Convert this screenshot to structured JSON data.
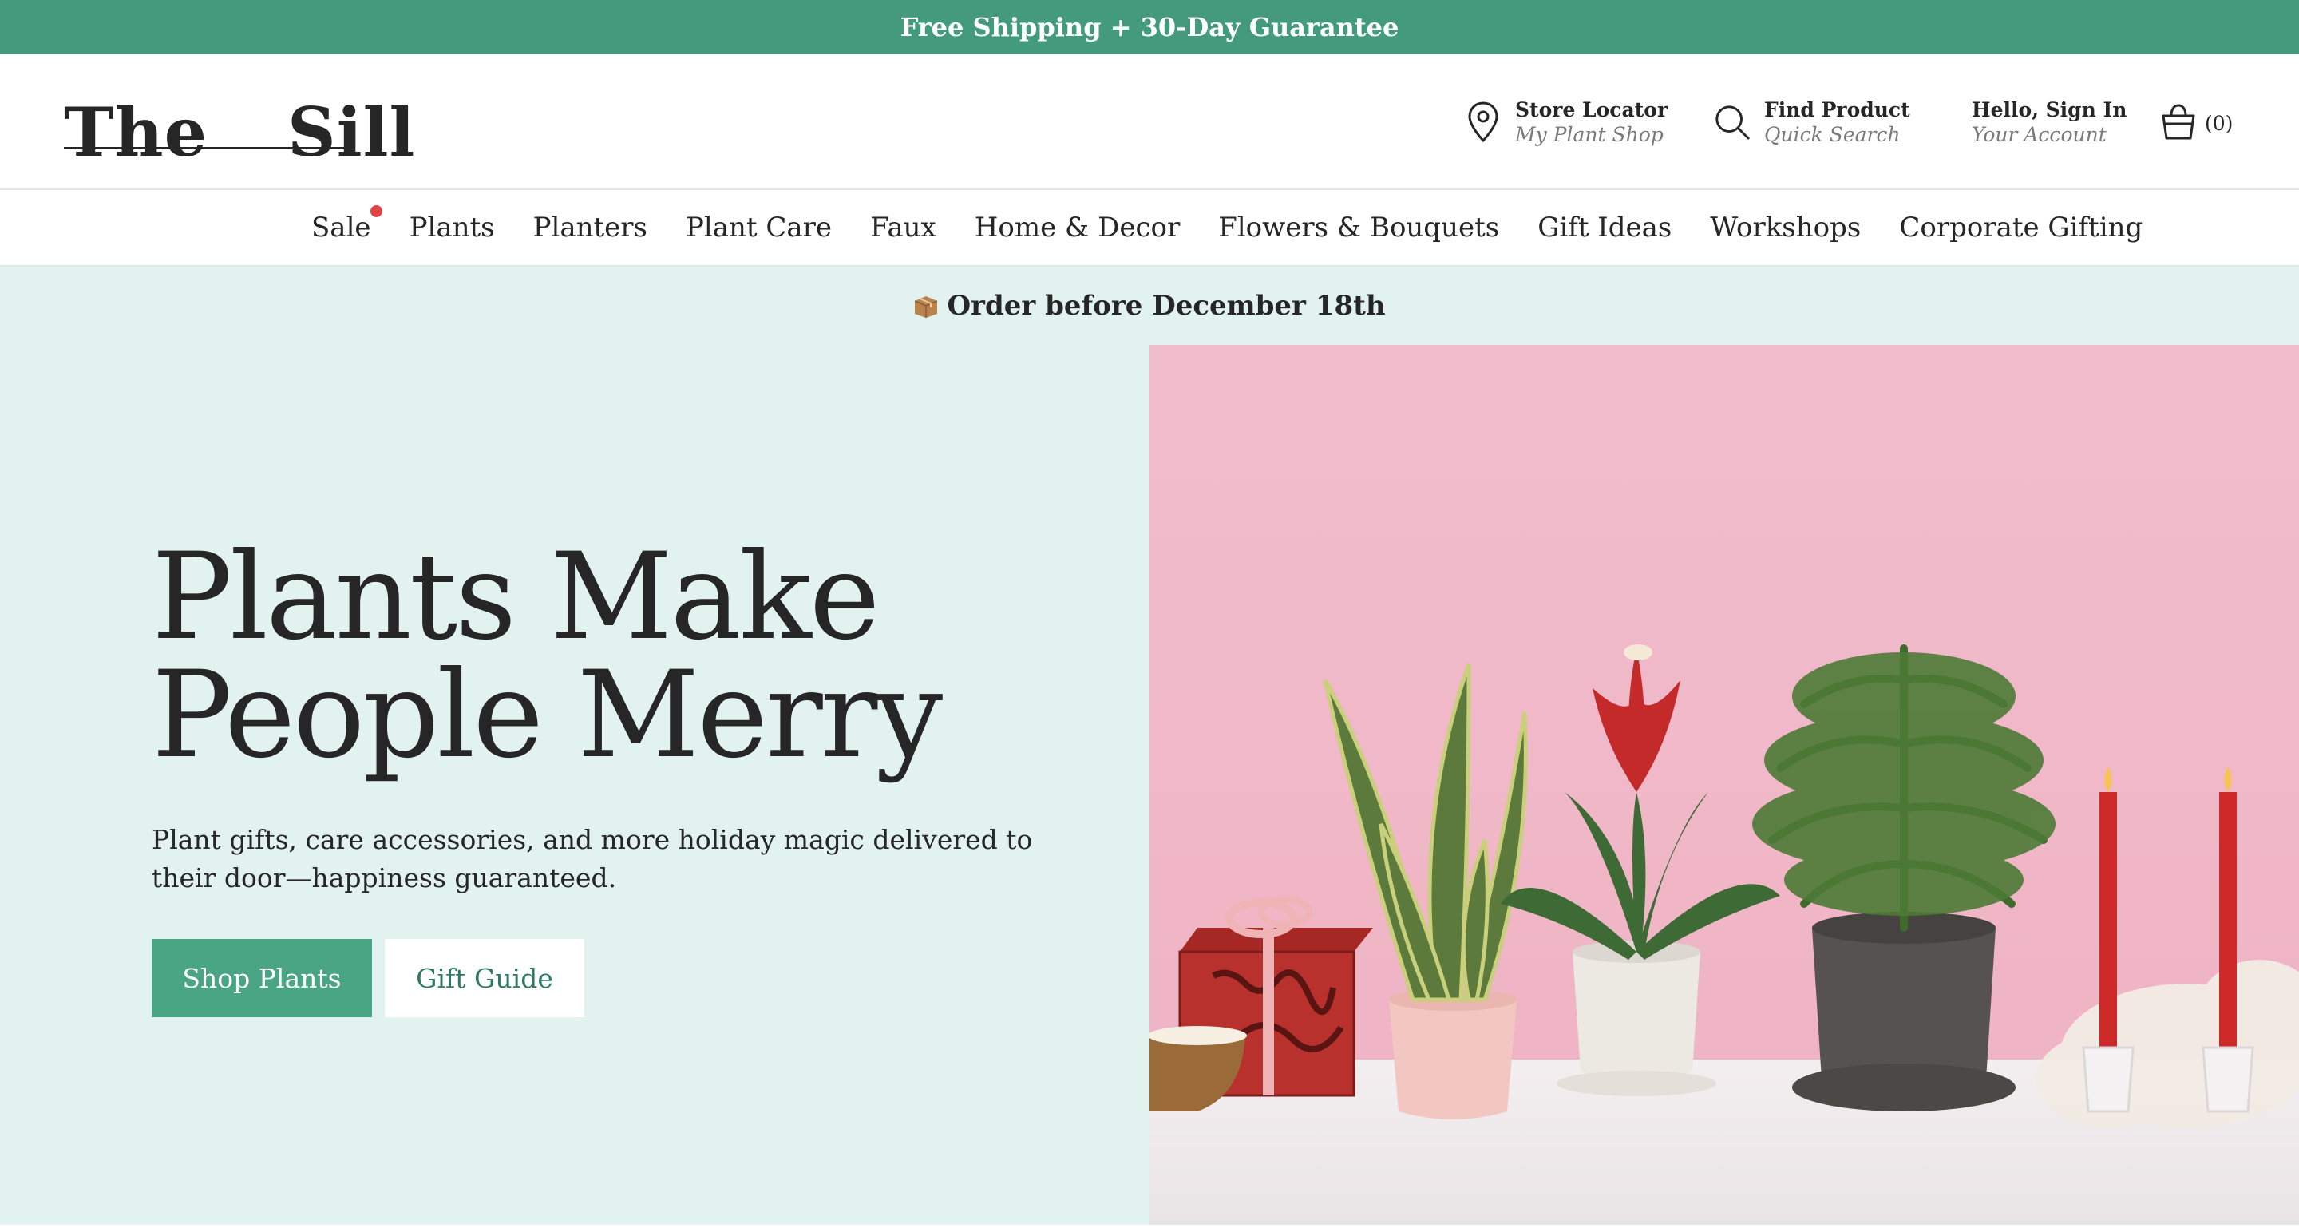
{
  "promo": {
    "text": "Free Shipping + 30-Day Guarantee"
  },
  "logo": {
    "word1": "The",
    "word2": "Sill"
  },
  "utility": {
    "store": {
      "title": "Store Locator",
      "subtitle": "My Plant Shop",
      "icon": "location-pin-icon"
    },
    "search": {
      "title": "Find Product",
      "subtitle": "Quick Search",
      "icon": "search-icon"
    },
    "account": {
      "title": "Hello, Sign In",
      "subtitle": "Your Account"
    },
    "cart": {
      "count": "(0)",
      "icon": "basket-icon"
    }
  },
  "nav": {
    "items": [
      {
        "label": "Sale"
      },
      {
        "label": "Plants"
      },
      {
        "label": "Planters"
      },
      {
        "label": "Plant Care"
      },
      {
        "label": "Faux"
      },
      {
        "label": "Home & Decor"
      },
      {
        "label": "Flowers & Bouquets"
      },
      {
        "label": "Gift Ideas"
      },
      {
        "label": "Workshops"
      },
      {
        "label": "Corporate Gifting"
      }
    ],
    "sale_dot_color": "#e04444"
  },
  "hero": {
    "announcement": "Order before December 18th",
    "announcement_icon": "package-icon",
    "headline_line1": "Plants Make",
    "headline_line2": "People Merry",
    "subcopy": "Plant gifts, care accessories, and more holiday magic delivered to their door—happiness guaranteed.",
    "primary_cta": "Shop Plants",
    "secondary_cta": "Gift Guide"
  },
  "colors": {
    "brand_green": "#449a7c",
    "button_green": "#4aa584",
    "hero_bg": "#e2f3ef",
    "photo_bg": "#f1bccb"
  }
}
